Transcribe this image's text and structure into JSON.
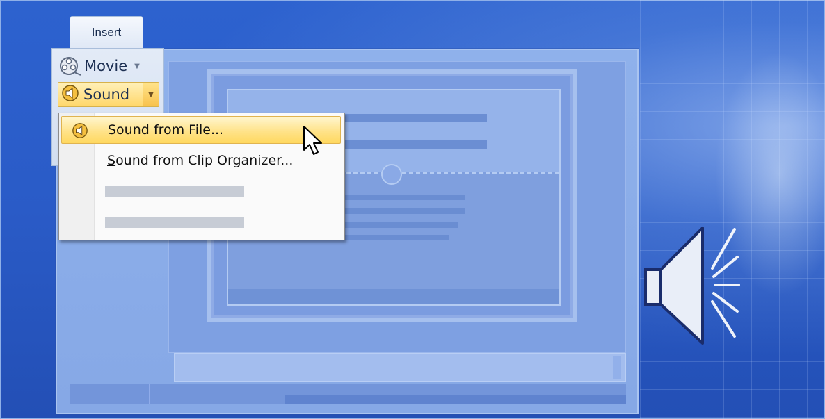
{
  "ribbon": {
    "tab_label": "Insert",
    "movie_label": "Movie",
    "sound_label": "Sound",
    "icons": {
      "movie": "film-reel-icon",
      "sound": "speaker-icon",
      "dropdown": "dropdown-arrow-icon"
    }
  },
  "menu": {
    "items": [
      {
        "pre": "Sound ",
        "accel": "f",
        "post": "rom File...",
        "highlighted": true,
        "icon": "speaker-icon"
      },
      {
        "pre": "",
        "accel": "S",
        "post": "ound from Clip Organizer...",
        "highlighted": false
      }
    ],
    "placeholder_items": 2
  },
  "decor": {
    "large_icon": "speaker-with-sound-waves-icon",
    "cursor": "mouse-pointer-icon"
  },
  "colors": {
    "background": "#2a5bc7",
    "highlight": "#ffe38a",
    "menu_bg": "#fafafa"
  }
}
